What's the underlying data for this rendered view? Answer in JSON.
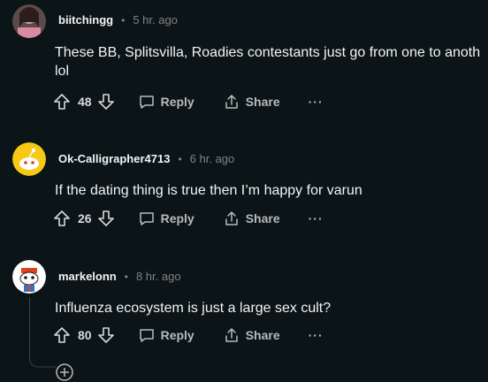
{
  "comments": [
    {
      "username": "biitchingg",
      "time": "5 hr. ago",
      "text_line1": "These BB, Splitsvilla, Roadies contestants just go from one to anoth",
      "text_line2": "lol",
      "score": "48",
      "reply_label": "Reply",
      "share_label": "Share",
      "more_label": "···"
    },
    {
      "username": "Ok-Calligrapher4713",
      "time": "6 hr. ago",
      "text_line1": "If the dating thing is true then I’m happy for varun",
      "score": "26",
      "reply_label": "Reply",
      "share_label": "Share",
      "more_label": "···"
    },
    {
      "username": "markelonn",
      "time": "8 hr. ago",
      "text_line1": "Influenza ecosystem is just a large sex cult?",
      "score": "80",
      "reply_label": "Reply",
      "share_label": "Share",
      "more_label": "···"
    }
  ],
  "separator": "•",
  "colors": {
    "background": "#0b1416",
    "text": "#f2f4f5",
    "muted": "#818384",
    "snoo_yellow": "#f5c915"
  }
}
